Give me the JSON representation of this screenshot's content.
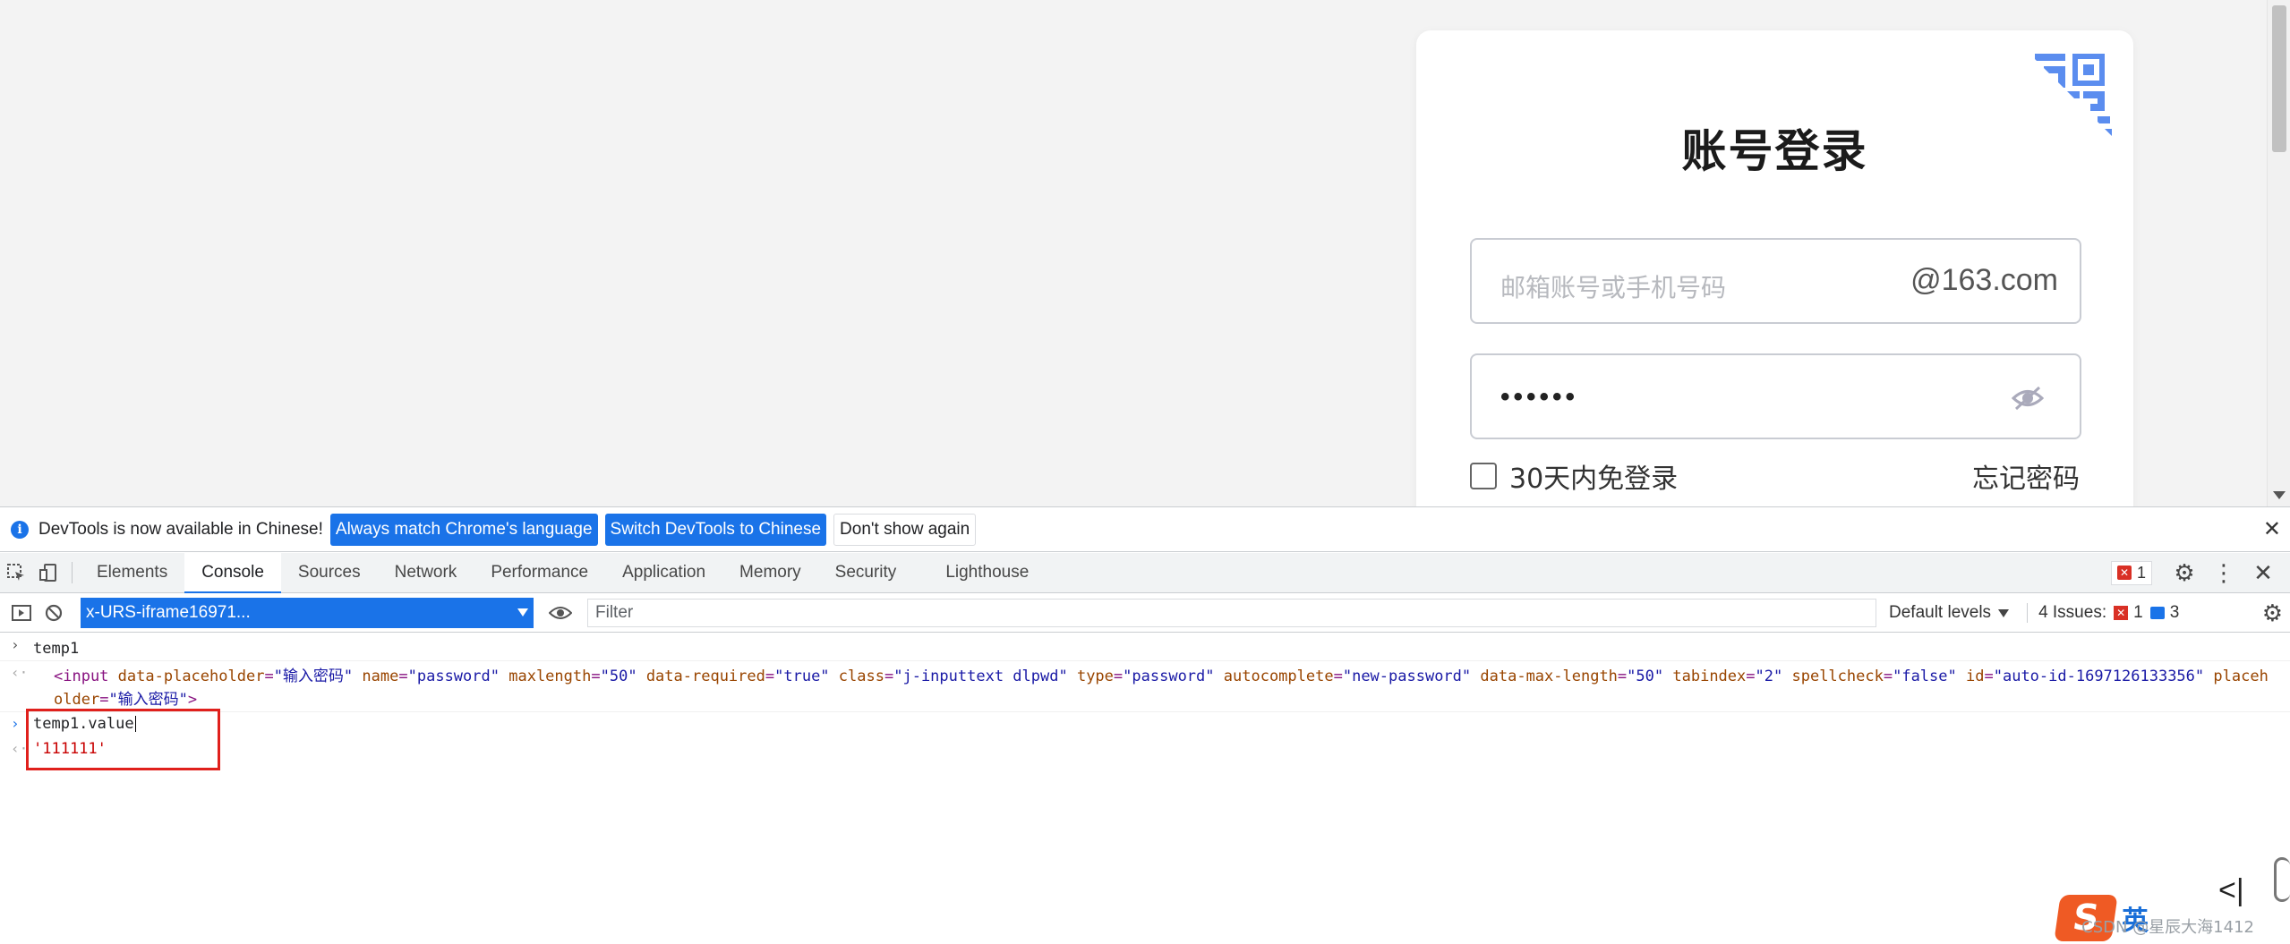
{
  "login": {
    "title": "账号登录",
    "email_placeholder": "邮箱账号或手机号码",
    "email_suffix": "@163.com",
    "password_value": "••••••",
    "remember_label": "30天内免登录",
    "forgot_label": "忘记密码"
  },
  "infobar": {
    "message": "DevTools is now available in Chinese!",
    "btn_match": "Always match Chrome's language",
    "btn_switch": "Switch DevTools to Chinese",
    "btn_dont_show": "Don't show again"
  },
  "tabs": [
    {
      "label": "Elements"
    },
    {
      "label": "Console"
    },
    {
      "label": "Sources"
    },
    {
      "label": "Network"
    },
    {
      "label": "Performance"
    },
    {
      "label": "Application"
    },
    {
      "label": "Memory"
    },
    {
      "label": "Security"
    },
    {
      "label": "Lighthouse"
    }
  ],
  "tabbar": {
    "error_count": "1"
  },
  "toolbar": {
    "context": "x-URS-iframe16971...",
    "filter_placeholder": "Filter",
    "levels": "Default levels",
    "issues_label": "4 Issues:",
    "issues_errors": "1",
    "issues_messages": "3"
  },
  "console": {
    "cmd1": "temp1",
    "out1": {
      "tag_open": "<input",
      "attrs": [
        {
          "name": "data-placeholder",
          "value": "\"输入密码\""
        },
        {
          "name": "name",
          "value": "\"password\""
        },
        {
          "name": "maxlength",
          "value": "\"50\""
        },
        {
          "name": "data-required",
          "value": "\"true\""
        },
        {
          "name": "class",
          "value": "\"j-inputtext dlpwd\""
        },
        {
          "name": "type",
          "value": "\"password\""
        },
        {
          "name": "autocomplete",
          "value": "\"new-password\""
        },
        {
          "name": "data-max-length",
          "value": "\"50\""
        },
        {
          "name": "tabindex",
          "value": "\"2\""
        },
        {
          "name": "spellcheck",
          "value": "\"false\""
        },
        {
          "name": "id",
          "value": "\"auto-id-1697126133356\""
        },
        {
          "name": "placeholder",
          "value": "\"输入密码\""
        }
      ],
      "tag_close": ">"
    },
    "cmd2": "temp1.value",
    "out2": "'111111'"
  },
  "overlay": {
    "ime_logo": "S",
    "ime_text": "英",
    "watermark": "CSDN @星辰大海1412"
  },
  "colors": {
    "accent": "#1a73e8",
    "qr_blue": "#5b8def",
    "highlight_red": "#e0201c"
  }
}
